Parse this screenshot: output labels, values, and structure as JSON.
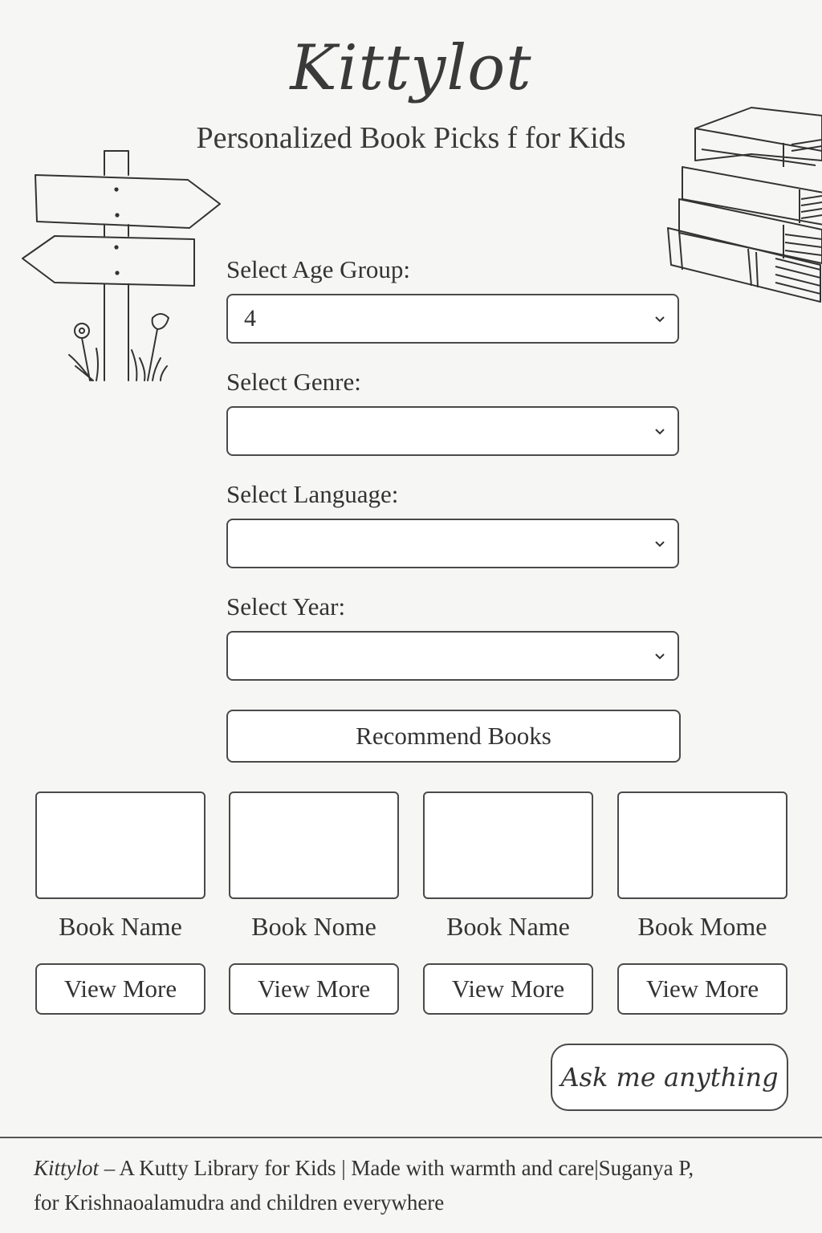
{
  "header": {
    "title": "Kittylot",
    "subtitle": "Personalized Book Picks f for Kids"
  },
  "form": {
    "age": {
      "label": "Select Age Group:",
      "value": "4"
    },
    "genre": {
      "label": "Select Genre:",
      "value": ""
    },
    "language": {
      "label": "Select Language:",
      "value": ""
    },
    "year": {
      "label": "Select Year:",
      "value": ""
    },
    "recommend_label": "Recommend Books"
  },
  "books": [
    {
      "name": "Book Name",
      "button": "View More"
    },
    {
      "name": "Book Nome",
      "button": "View More"
    },
    {
      "name": "Book Name",
      "button": "View More"
    },
    {
      "name": "Book Mome",
      "button": "View More"
    }
  ],
  "ask_label": "Ask me anything",
  "footer": {
    "brand": "Kittylot",
    "line1_rest": " – A Kutty Library for Kids | Made with warmth and care|Suganya P,",
    "line2": "for Krishnaoalamudra and children everywhere"
  },
  "icons": {
    "signpost": "signpost-illustration",
    "books": "book-stack-illustration",
    "dropdown": "chevron-down-icon"
  }
}
